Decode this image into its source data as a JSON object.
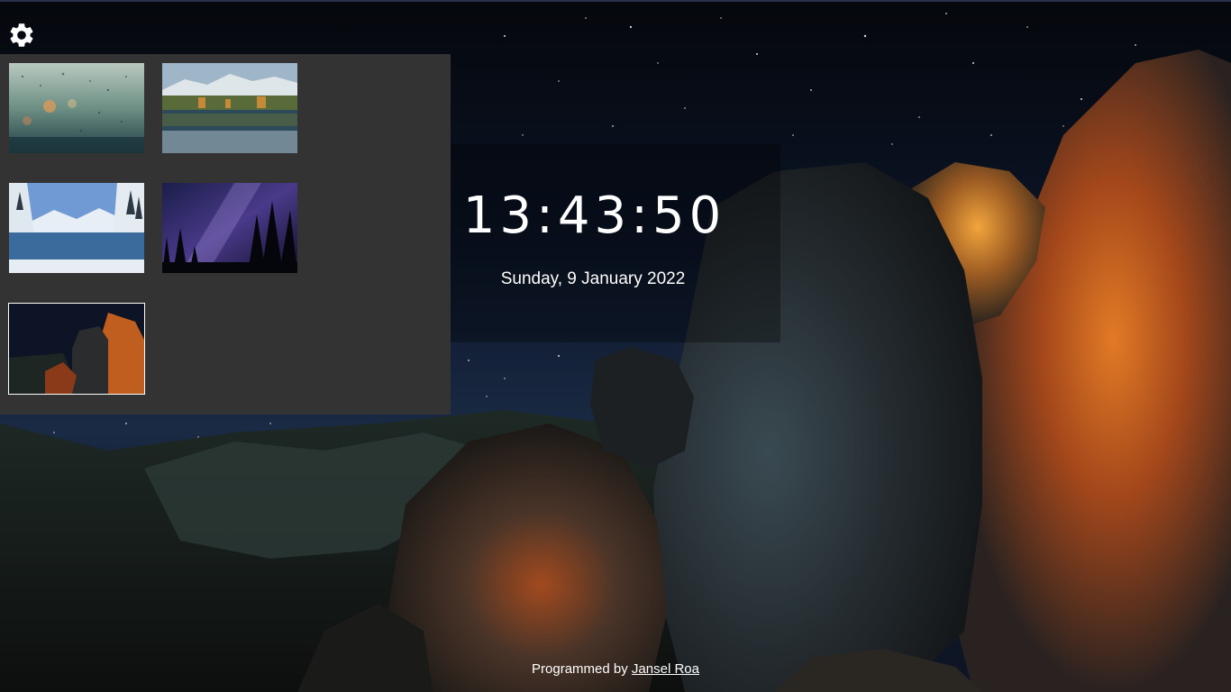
{
  "clock": {
    "time": "13:43:50",
    "date": "Sunday, 9 January 2022"
  },
  "footer": {
    "prefix": "Programmed by",
    "author_link": "Jansel Roa"
  },
  "settings": {
    "icon": "gear-icon"
  },
  "wallpapers": [
    {
      "name": "rainy-window",
      "selected": false
    },
    {
      "name": "mountain-lake-reflection",
      "selected": false
    },
    {
      "name": "snowy-river",
      "selected": false
    },
    {
      "name": "milky-way-forest",
      "selected": false
    },
    {
      "name": "night-rocks",
      "selected": true
    }
  ],
  "colors": {
    "panel_bg": "#333333",
    "text": "#ffffff",
    "selected_border": "#ffffff"
  }
}
